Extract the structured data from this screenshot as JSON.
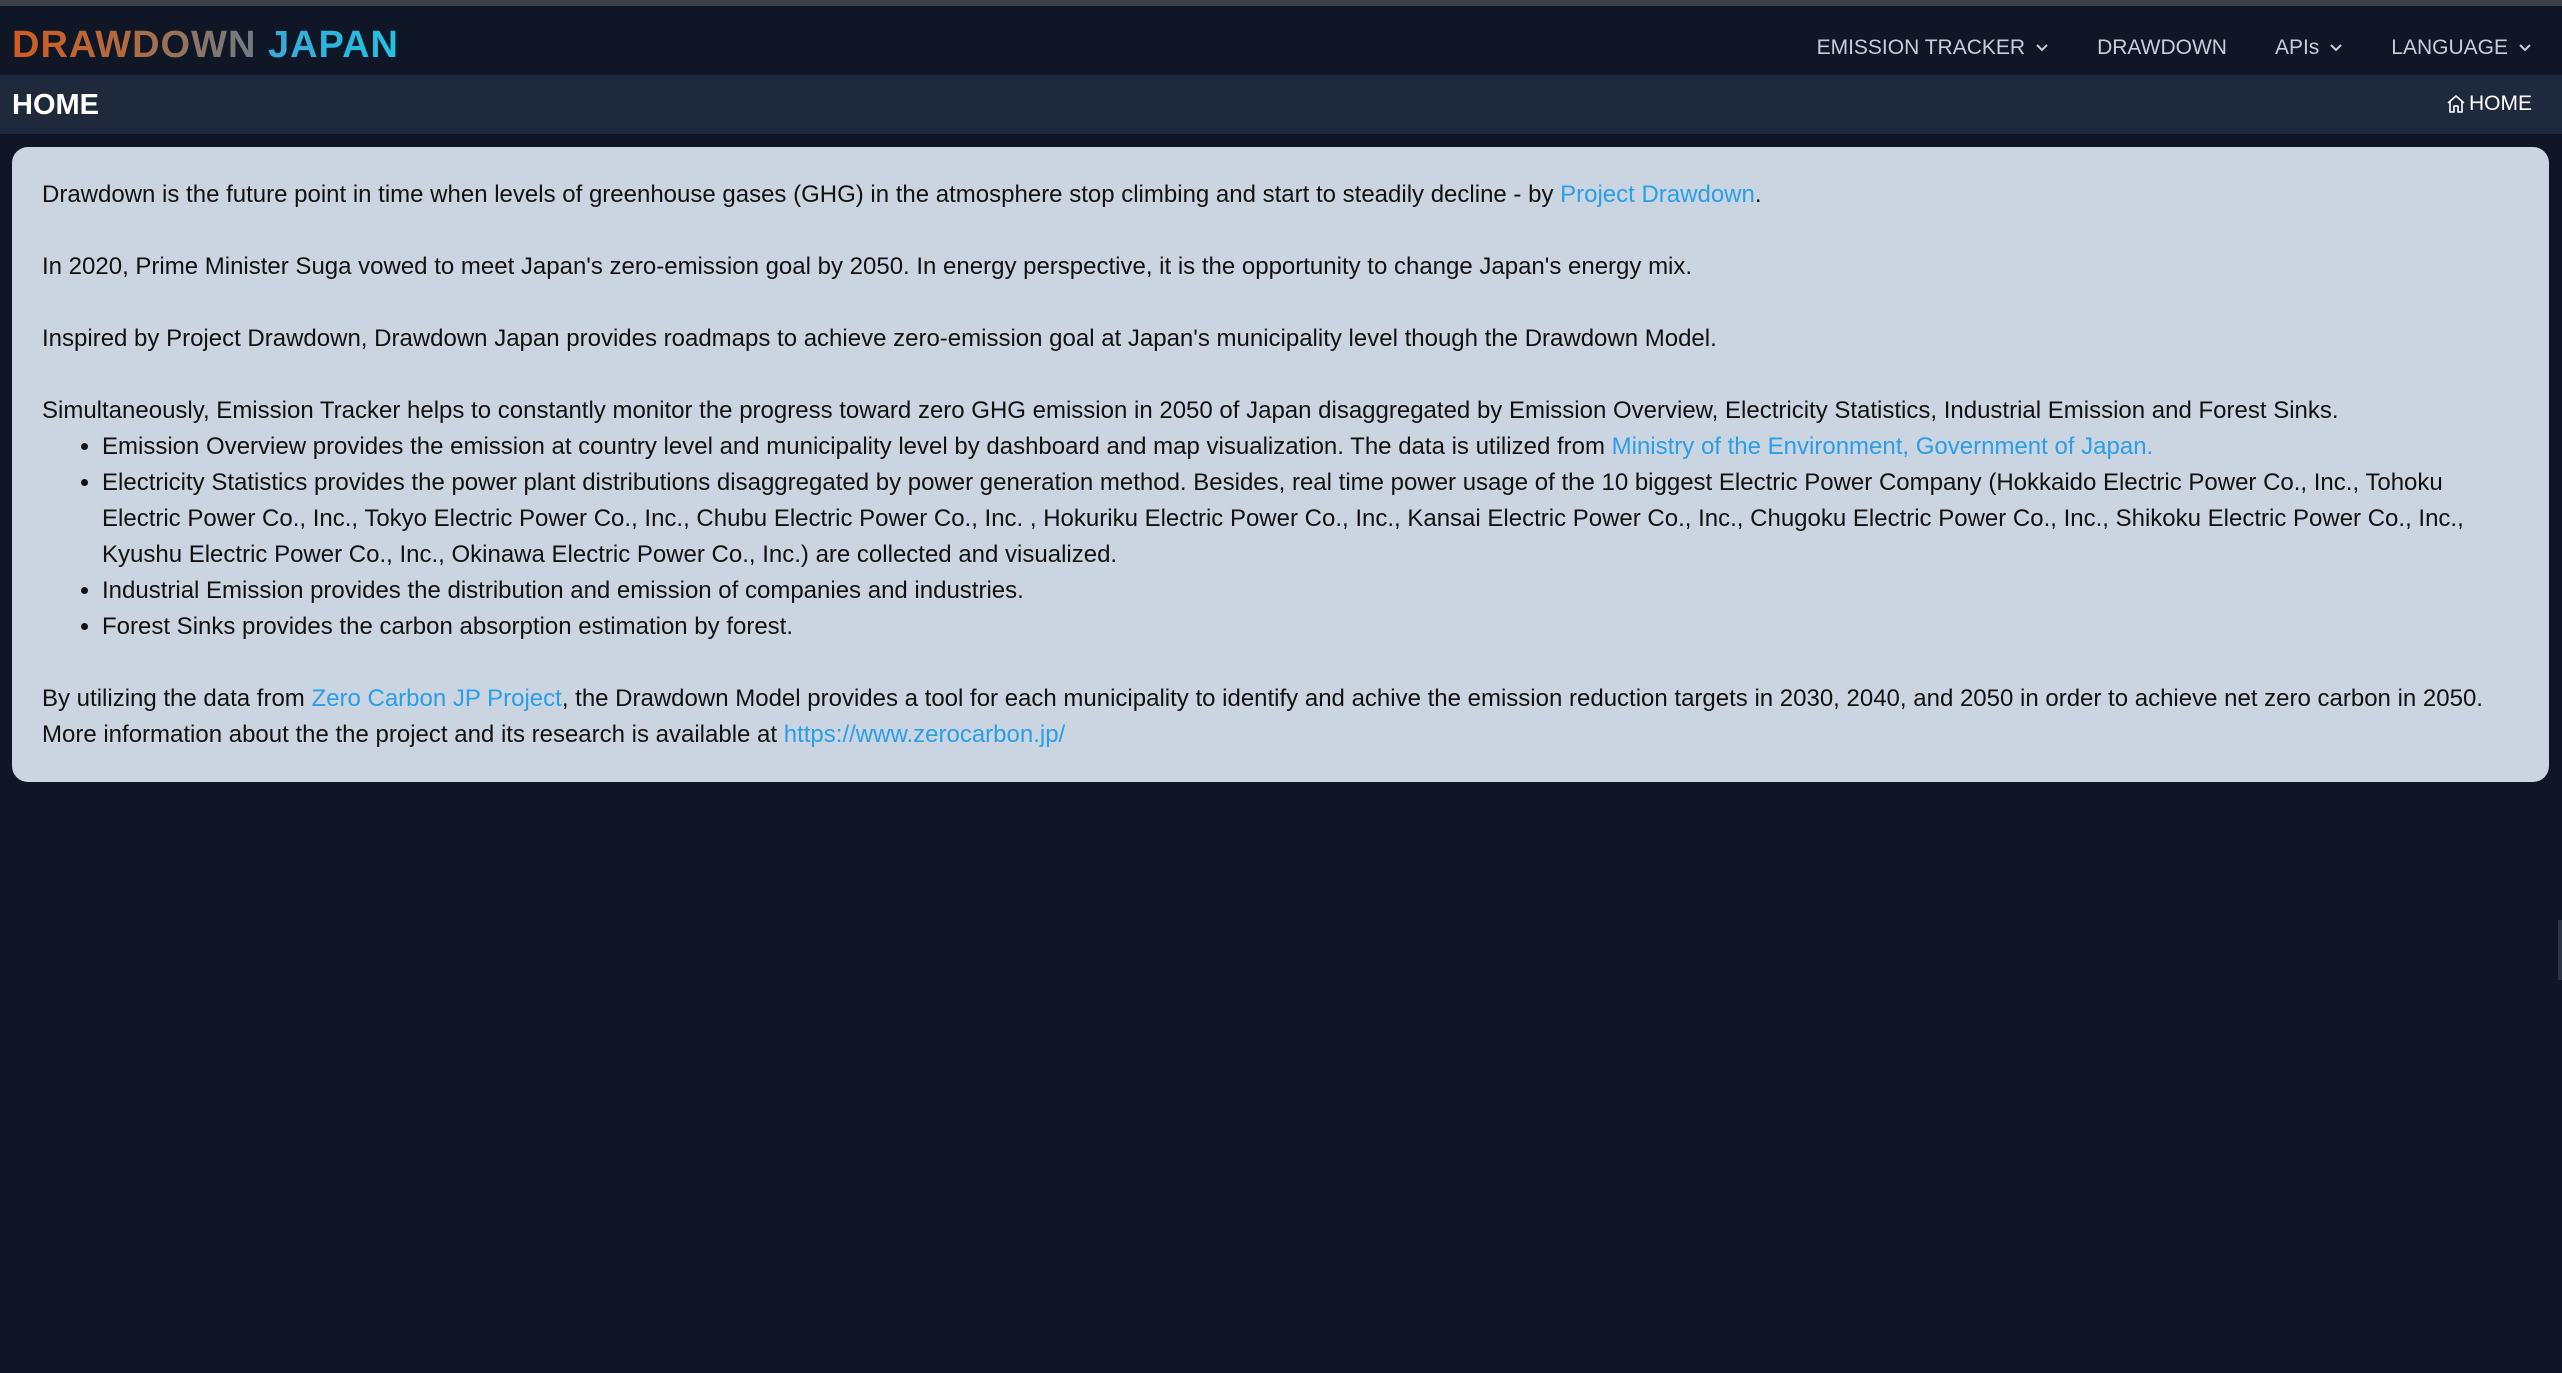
{
  "brand": {
    "word1": "DRAWDOWN",
    "word2": "JAPAN"
  },
  "nav": [
    {
      "label": "EMISSION TRACKER",
      "has_dropdown": true
    },
    {
      "label": "DRAWDOWN",
      "has_dropdown": false
    },
    {
      "label": "APIs",
      "has_dropdown": true
    },
    {
      "label": "LANGUAGE",
      "has_dropdown": true
    }
  ],
  "page": {
    "title": "HOME",
    "breadcrumb": "HOME"
  },
  "content": {
    "p1": {
      "text": "Drawdown is the future point in time when levels of greenhouse gases (GHG) in the atmosphere stop climbing and start to steadily decline - by ",
      "link": "Project Drawdown",
      "after": "."
    },
    "p2": "In 2020, Prime Minister Suga vowed to meet Japan's zero-emission goal by 2050. In energy perspective, it is the opportunity to change Japan's energy mix.",
    "p3": "Inspired by Project Drawdown, Drawdown Japan provides roadmaps to achieve zero-emission goal at Japan's municipality level though the Drawdown Model.",
    "p4": "Simultaneously, Emission Tracker helps to constantly monitor the progress toward zero GHG emission in 2050 of Japan disaggregated by Emission Overview, Electricity Statistics, Industrial Emission and Forest Sinks.",
    "bullets": {
      "b1": {
        "text": "Emission Overview provides the emission at country level and municipality level by dashboard and map visualization. The data is utilized from ",
        "link": "Ministry of the Environment, Government of Japan."
      },
      "b2": "Electricity Statistics provides the power plant distributions disaggregated by power generation method. Besides, real time power usage of the 10 biggest Electric Power Company (Hokkaido Electric Power Co., Inc., Tohoku Electric Power Co., Inc., Tokyo Electric Power Co., Inc., Chubu Electric Power Co., Inc. , Hokuriku Electric Power Co., Inc., Kansai Electric Power Co., Inc., Chugoku Electric Power Co., Inc., Shikoku Electric Power Co., Inc., Kyushu Electric Power Co., Inc., Okinawa Electric Power Co., Inc.) are collected and visualized.",
      "b3": "Industrial Emission provides the distribution and emission of companies and industries.",
      "b4": "Forest Sinks provides the carbon absorption estimation by forest."
    },
    "p5": {
      "before": "By utilizing the data from ",
      "link1": "Zero Carbon JP Project",
      "middle": ", the Drawdown Model provides a tool for each municipality to identify and achive the emission reduction targets in 2030, 2040, and 2050 in order to achieve net zero carbon in 2050. More information about the the project and its research is available at ",
      "link2": "https://www.zerocarbon.jp/"
    }
  },
  "colors": {
    "background": "#0f1727",
    "subbar": "#1e293b",
    "card": "#cbd5e1",
    "link": "#2a9ee6"
  },
  "icons": {
    "dropdown": "chevron-down-icon",
    "breadcrumb": "home-icon"
  }
}
